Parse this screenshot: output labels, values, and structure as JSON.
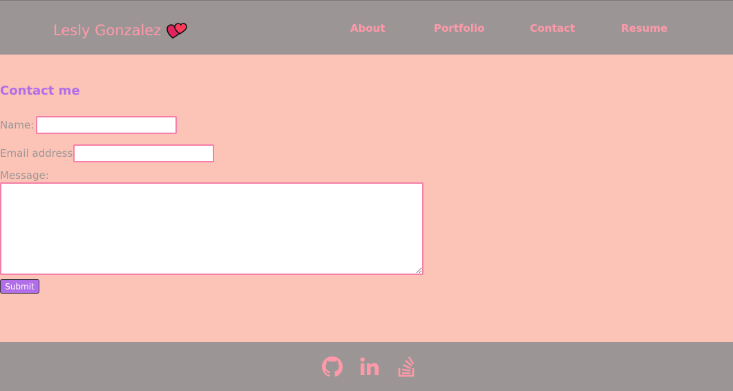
{
  "header": {
    "brand": "Lesly Gonzalez",
    "brand_icon": "two-hearts-icon",
    "nav": [
      "About",
      "Portfolio",
      "Contact",
      "Resume"
    ]
  },
  "contact": {
    "heading": "Contact me",
    "name_label": "Name:",
    "email_label": "Email address:",
    "message_label": "Message:",
    "name_value": "",
    "email_value": "",
    "message_value": "",
    "submit_label": "Submit"
  },
  "footer": {
    "social": [
      "github-icon",
      "linkedin-icon",
      "stackoverflow-icon"
    ]
  },
  "colors": {
    "background": "#fcc3b7",
    "header": "#9b9695",
    "accent_pink": "#ff99aa",
    "accent_purple": "#b16ee8",
    "input_border": "#f57fa8"
  }
}
